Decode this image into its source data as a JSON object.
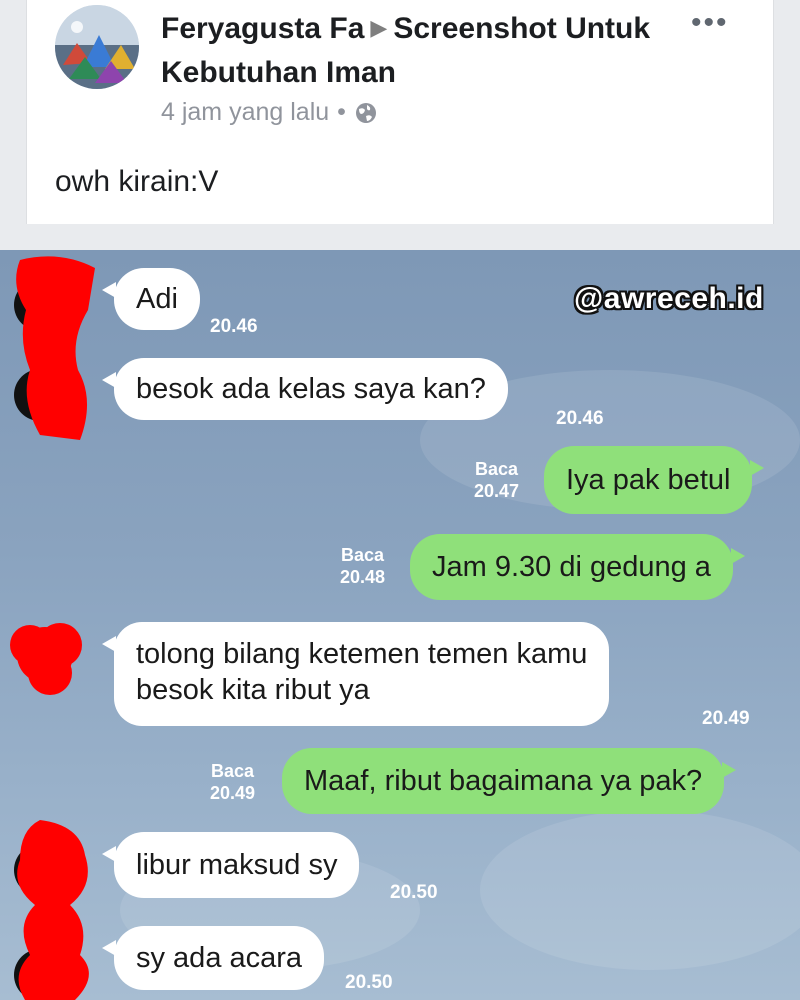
{
  "post": {
    "author": "Feryagusta Fa",
    "arrow": "▶",
    "group": "Screenshot Untuk Kebutuhan Iman",
    "time": "4 jam yang lalu",
    "separator": "•",
    "text": "owh kirain:V",
    "more_icon": "more-options-icon",
    "privacy_icon": "globe-icon"
  },
  "chat": {
    "watermark": "@awreceh.id",
    "read_label": "Baca",
    "messages": [
      {
        "side": "in",
        "text": "Adi",
        "time": "20.46"
      },
      {
        "side": "in",
        "text": "besok ada kelas saya kan?",
        "time": "20.46"
      },
      {
        "side": "out",
        "text": "Iya pak betul",
        "time": "20.47",
        "status": "Baca"
      },
      {
        "side": "out",
        "text": "Jam 9.30 di gedung a",
        "time": "20.48",
        "status": "Baca"
      },
      {
        "side": "in",
        "text": "tolong bilang ketemen temen kamu",
        "text2": "besok kita ribut ya",
        "time": "20.49"
      },
      {
        "side": "out",
        "text": "Maaf, ribut bagaimana ya pak?",
        "time": "20.49",
        "status": "Baca"
      },
      {
        "side": "in",
        "text": "libur maksud sy",
        "time": "20.50"
      },
      {
        "side": "in",
        "text": "sy ada acara",
        "time": "20.50"
      }
    ]
  },
  "colors": {
    "incoming_bubble": "#ffffff",
    "outgoing_bubble": "#8fe07a",
    "chat_background": "#8aa3bf",
    "redaction": "#ff0000"
  }
}
